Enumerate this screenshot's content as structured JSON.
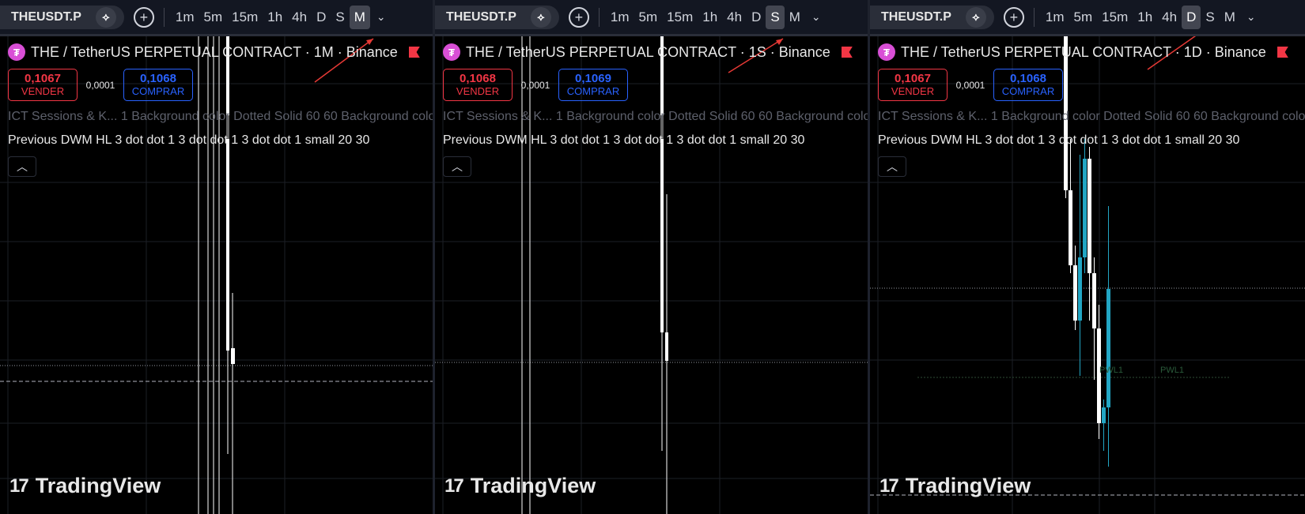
{
  "panels": [
    {
      "toolbar": {
        "symbol": "THEUSDT.P",
        "timeframes": [
          "1m",
          "5m",
          "15m",
          "1h",
          "4h",
          "D",
          "S",
          "M"
        ],
        "active_timeframe": "M"
      },
      "legend": {
        "title": "THE / TetherUS PERPETUAL CONTRACT · 1M · Binance"
      },
      "trade": {
        "sell_price": "0,1067",
        "sell_label": "VENDER",
        "spread": "0,0001",
        "buy_price": "0,1068",
        "buy_label": "COMPRAR"
      },
      "indicators": {
        "line1": "ICT Sessions & K... 1 Background color Dotted Solid 60 60 Background color",
        "line2": "Previous DWM HL 3 dot dot 1 3 dot dot 1 3 dot dot 1 small 20 30"
      },
      "watermark": "TradingView"
    },
    {
      "toolbar": {
        "symbol": "THEUSDT.P",
        "timeframes": [
          "1m",
          "5m",
          "15m",
          "1h",
          "4h",
          "D",
          "S",
          "M"
        ],
        "active_timeframe": "S"
      },
      "legend": {
        "title": "THE / TetherUS PERPETUAL CONTRACT · 1S · Binance"
      },
      "trade": {
        "sell_price": "0,1068",
        "sell_label": "VENDER",
        "spread": "0,0001",
        "buy_price": "0,1069",
        "buy_label": "COMPRAR"
      },
      "indicators": {
        "line1": "ICT Sessions & K... 1 Background color Dotted Solid 60 60 Background color",
        "line2": "Previous DWM HL 3 dot dot 1 3 dot dot 1 3 dot dot 1 small 20 30"
      },
      "watermark": "TradingView"
    },
    {
      "toolbar": {
        "symbol": "THEUSDT.P",
        "timeframes": [
          "1m",
          "5m",
          "15m",
          "1h",
          "4h",
          "D",
          "S",
          "M"
        ],
        "active_timeframe": "D"
      },
      "legend": {
        "title": "THE / TetherUS PERPETUAL CONTRACT · 1D · Binance"
      },
      "trade": {
        "sell_price": "0,1067",
        "sell_label": "VENDER",
        "spread": "0,0001",
        "buy_price": "0,1068",
        "buy_label": "COMPRAR"
      },
      "indicators": {
        "line1": "ICT Sessions & K... 1 Background color Dotted Solid 60 60 Background color",
        "line2": "Previous DWM HL 3 dot dot 1 3 dot dot 1 3 dot dot 1 small 20 30"
      },
      "watermark": "TradingView",
      "levels": [
        "PWL1",
        "PWL1"
      ]
    }
  ],
  "colors": {
    "sell": "#f23645",
    "buy": "#2962ff",
    "bull_candle": "#22a6c4",
    "bear_candle": "#ffffff",
    "arrow": "#e53935"
  }
}
